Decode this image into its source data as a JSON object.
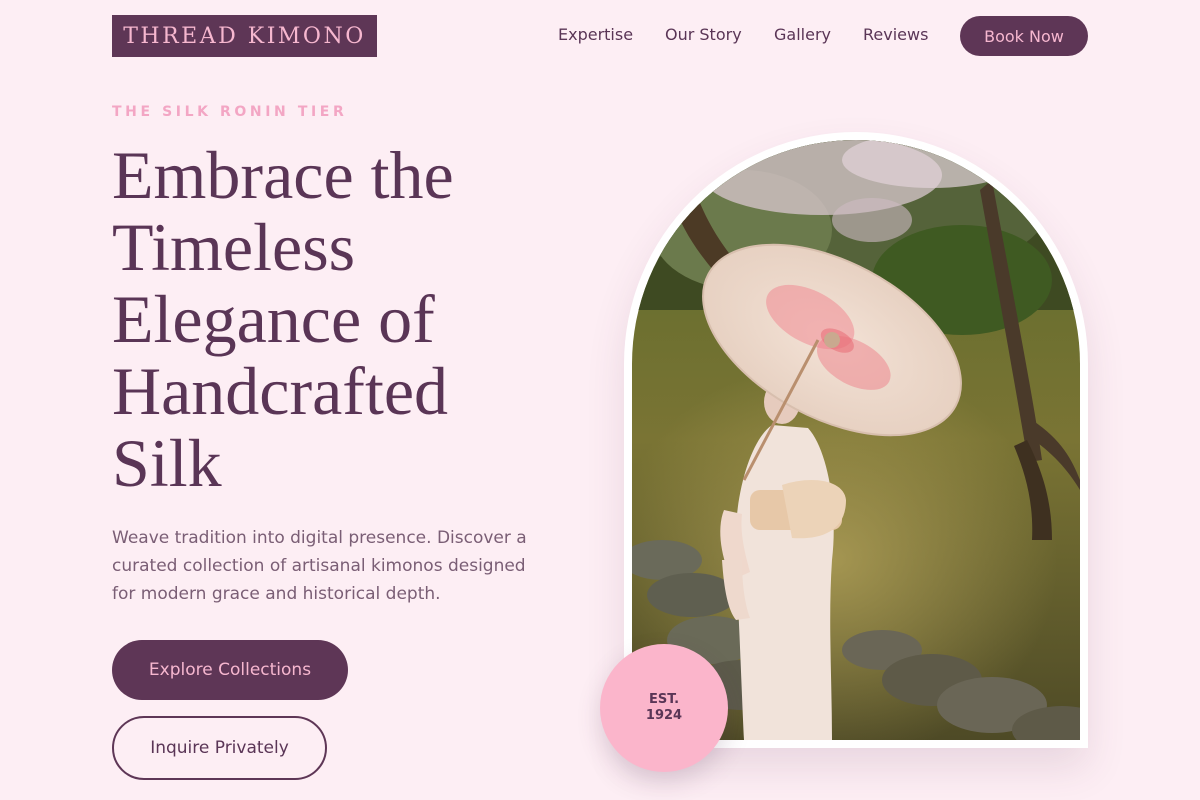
{
  "brand": {
    "name": "THREAD KIMONO"
  },
  "nav": {
    "links": [
      "Expertise",
      "Our Story",
      "Gallery",
      "Reviews"
    ],
    "cta": "Book Now"
  },
  "hero": {
    "eyebrow": "THE SILK RONIN TIER",
    "headline_lines": [
      "Embrace the",
      "Timeless",
      "Elegance of",
      "Handcrafted",
      "Silk"
    ],
    "subtitle_lines": [
      "Weave tradition into digital presence. Discover a",
      "curated collection of artisanal kimonos designed",
      "for modern grace and historical depth."
    ],
    "primary_cta": "Explore Collections",
    "secondary_cta": "Inquire Privately"
  },
  "badge": {
    "line1": "EST.",
    "line2": "1924"
  },
  "colors": {
    "background": "#fdeef4",
    "plum": "#5e3656",
    "pink": "#f6b7cf",
    "badge_pink": "#fbb5cb"
  }
}
